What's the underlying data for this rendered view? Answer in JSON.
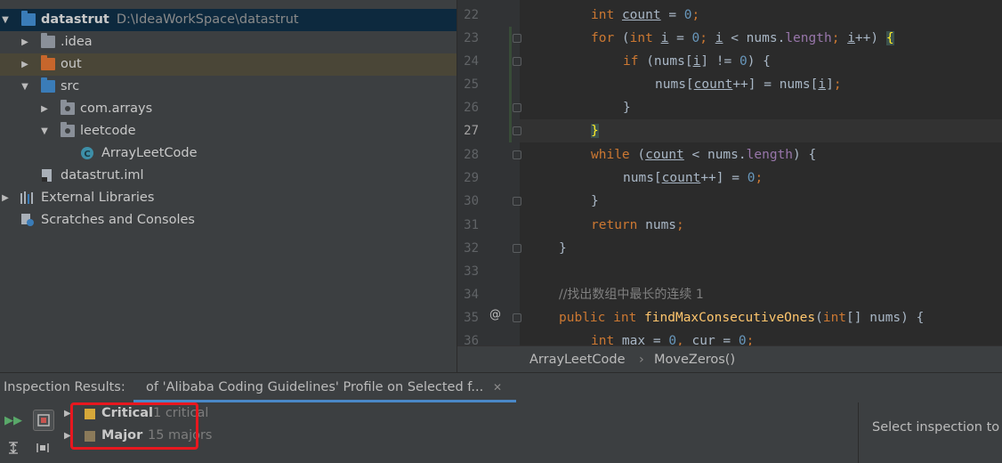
{
  "project": {
    "rows": [
      {
        "label": "datastrut",
        "path": "D:\\IdeaWorkSpace\\datastrut"
      },
      {
        "label": ".idea"
      },
      {
        "label": "out"
      },
      {
        "label": "src"
      },
      {
        "label": "com.arrays"
      },
      {
        "label": "leetcode"
      },
      {
        "label": "ArrayLeetCode"
      },
      {
        "label": "datastrut.iml"
      },
      {
        "label": "External Libraries"
      },
      {
        "label": "Scratches and Consoles"
      }
    ]
  },
  "editor": {
    "line_numbers": [
      "22",
      "23",
      "24",
      "25",
      "26",
      "27",
      "28",
      "29",
      "30",
      "31",
      "32",
      "33",
      "34",
      "35",
      "36"
    ],
    "comment_line": "//找出数组中最长的连续 1",
    "annotation_marker": "@"
  },
  "breadcrumb": {
    "items": [
      "ArrayLeetCode",
      "MoveZeros()"
    ],
    "separator": "›"
  },
  "inspection": {
    "title": "Inspection Results:",
    "tab_label": "of 'Alibaba Coding Guidelines' Profile on Selected f...",
    "tab_close": "✕",
    "results": [
      {
        "name": "Critical",
        "count": "1 critical",
        "color": "#d6a83a"
      },
      {
        "name": "Major",
        "count": "15 majors",
        "color": "#8b7a5a"
      }
    ],
    "detail_text": "Select inspection to"
  },
  "colors": {
    "accent": "#4a88c7",
    "highlight_box": "#e8171f"
  }
}
